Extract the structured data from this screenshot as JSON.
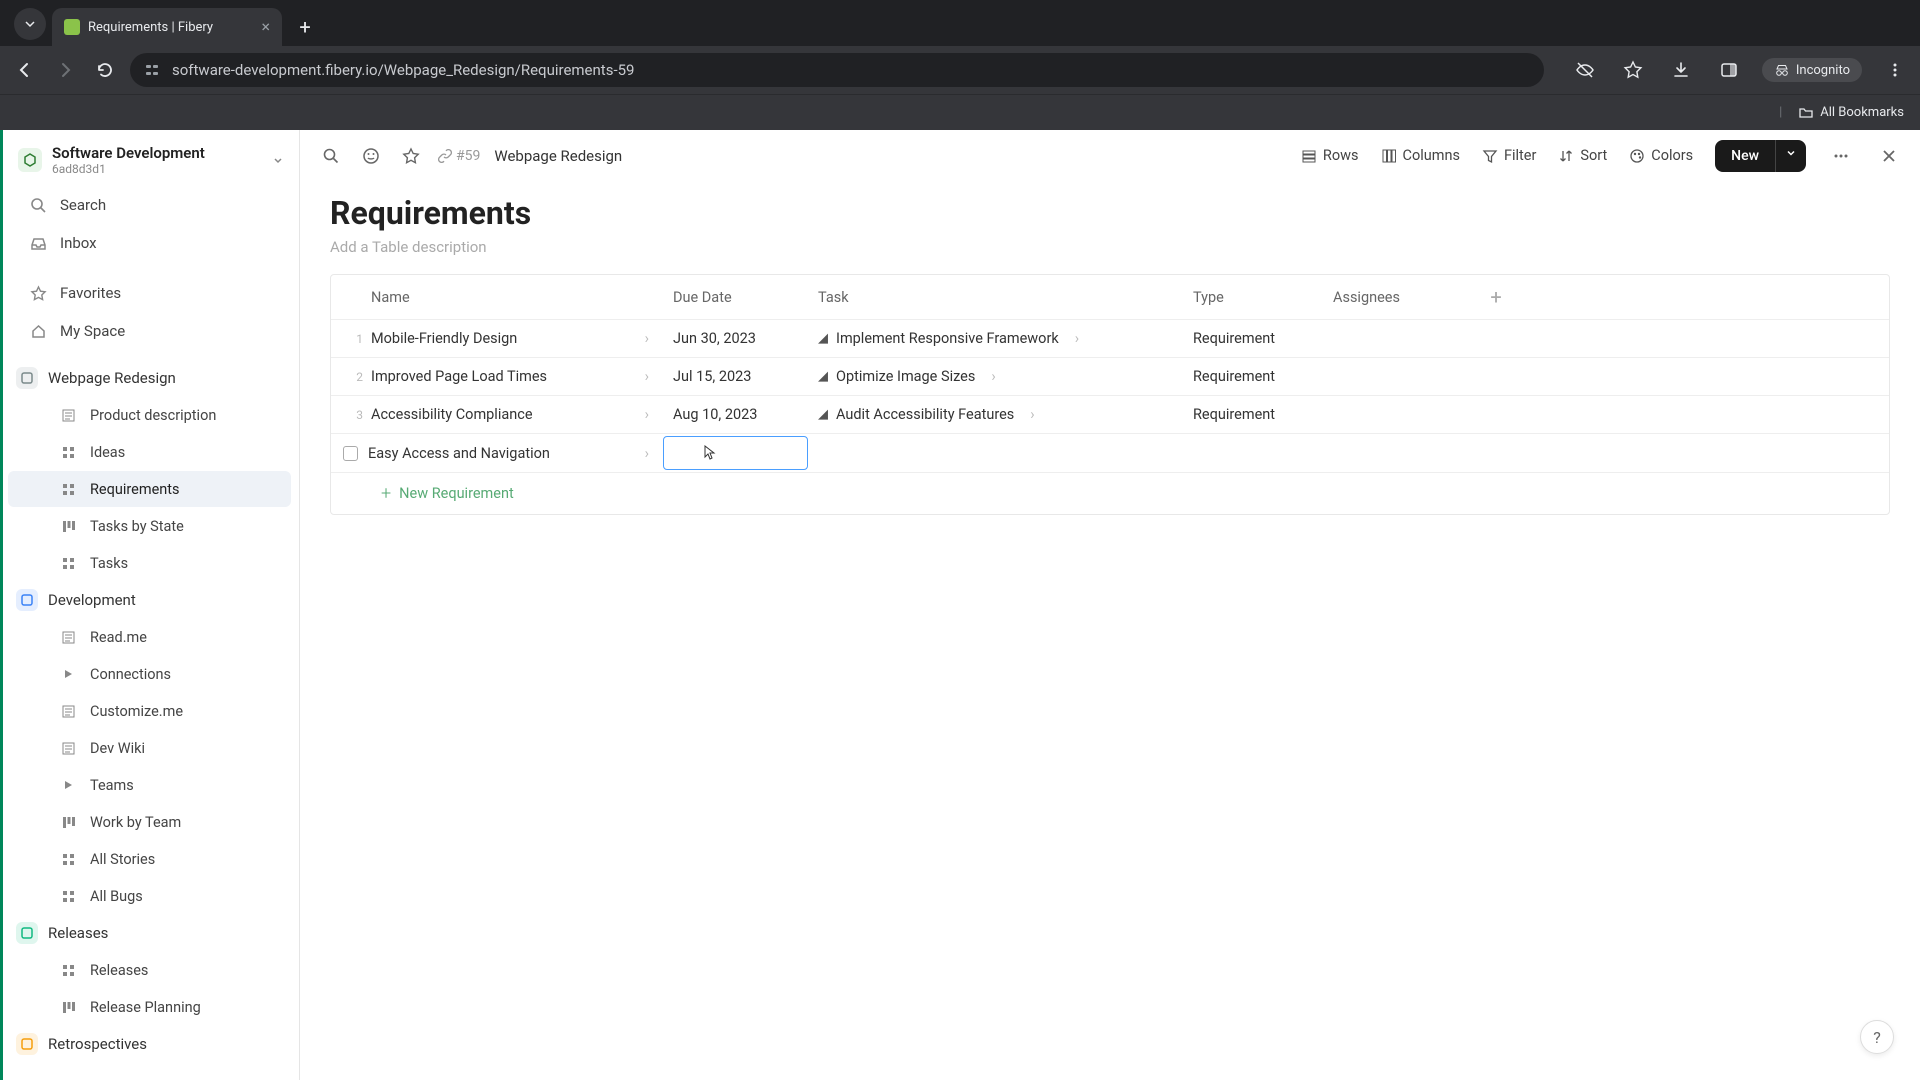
{
  "browser": {
    "tab_title": "Requirements | Fibery",
    "url": "software-development.fibery.io/Webpage_Redesign/Requirements-59",
    "incognito_label": "Incognito",
    "all_bookmarks": "All Bookmarks"
  },
  "workspace": {
    "name": "Software Development",
    "id": "6ad8d3d1"
  },
  "sidebar": {
    "search": "Search",
    "inbox": "Inbox",
    "favorites": "Favorites",
    "my_space": "My Space",
    "spaces": [
      {
        "name": "Webpage Redesign",
        "color": "#7b8a8b",
        "items": [
          "Product description",
          "Ideas",
          "Requirements",
          "Tasks by State",
          "Tasks"
        ],
        "active_index": 2
      },
      {
        "name": "Development",
        "color": "#3b82f6",
        "items": [
          "Read.me",
          "Connections",
          "Customize.me",
          "Dev Wiki",
          "Teams",
          "Work by Team",
          "All Stories",
          "All Bugs"
        ]
      },
      {
        "name": "Releases",
        "color": "#10b981",
        "items": [
          "Releases",
          "Release Planning"
        ]
      },
      {
        "name": "Retrospectives",
        "color": "#f59e0b",
        "items": []
      }
    ]
  },
  "page": {
    "breadcrumb_id": "#59",
    "breadcrumb_name": "Webpage Redesign",
    "title": "Requirements",
    "description_placeholder": "Add a Table description"
  },
  "topbar_tools": {
    "rows": "Rows",
    "columns": "Columns",
    "filter": "Filter",
    "sort": "Sort",
    "colors": "Colors",
    "new": "New"
  },
  "table": {
    "columns": [
      "Name",
      "Due Date",
      "Task",
      "Type",
      "Assignees"
    ],
    "rows": [
      {
        "num": "1",
        "name": "Mobile-Friendly Design",
        "due": "Jun 30, 2023",
        "task": "Implement Responsive Framework",
        "type": "Requirement"
      },
      {
        "num": "2",
        "name": "Improved Page Load Times",
        "due": "Jul 15, 2023",
        "task": "Optimize Image Sizes",
        "type": "Requirement"
      },
      {
        "num": "3",
        "name": "Accessibility Compliance",
        "due": "Aug 10, 2023",
        "task": "Audit Accessibility Features",
        "type": "Requirement"
      },
      {
        "num": "",
        "name": "Easy Access and Navigation",
        "due": "",
        "task": "",
        "type": "",
        "editing": true
      }
    ],
    "new_row_label": "New Requirement"
  },
  "help": "?"
}
